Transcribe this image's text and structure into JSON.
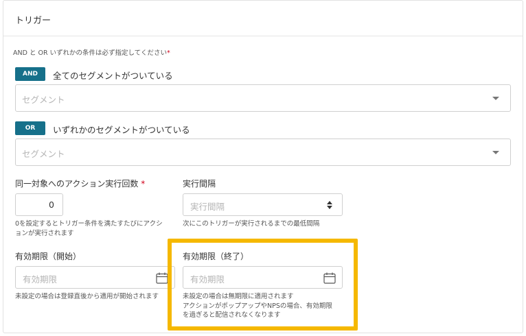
{
  "panel": {
    "title": "トリガー"
  },
  "condition_hint": {
    "text": "AND と OR いずれかの条件は必ず指定してください",
    "required_mark": "*"
  },
  "and_condition": {
    "badge": "AND",
    "label": "全てのセグメントがついている",
    "select_placeholder": "セグメント"
  },
  "or_condition": {
    "badge": "OR",
    "label": "いずれかのセグメントがついている",
    "select_placeholder": "セグメント"
  },
  "execution_count": {
    "label": "同一対象へのアクション実行回数",
    "required_mark": "*",
    "value": "0",
    "help_line1": "0を設定するとトリガー条件を満たすたびにアクシ",
    "help_line2": "ョンが実行されます"
  },
  "execution_interval": {
    "label": "実行間隔",
    "placeholder": "実行間隔",
    "help": "次にこのトリガーが実行されるまでの最低間隔"
  },
  "valid_start": {
    "label": "有効期限（開始）",
    "placeholder": "有効期限",
    "help": "未設定の場合は登録直後から適用が開始されます"
  },
  "valid_end": {
    "label": "有効期限（終了）",
    "placeholder": "有効期限",
    "help_line1": "未設定の場合は無期限に適用されます",
    "help_line2": "アクションがポップアップやNPSの場合、有効期限",
    "help_line3": "を過ぎると配信されなくなります"
  },
  "icons": {
    "dropdown": "chevron-down-icon",
    "calendar": "calendar-icon",
    "spinner": "updown-arrows-icon"
  },
  "colors": {
    "badge": "#16708a",
    "highlight": "#f5b800",
    "required": "#d0021b"
  }
}
